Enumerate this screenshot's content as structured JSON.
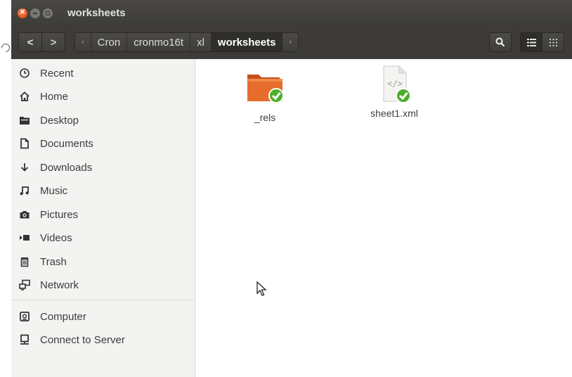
{
  "window": {
    "title": "worksheets"
  },
  "toolbar": {
    "back_glyph": "<",
    "forward_glyph": ">",
    "breadcrumb": [
      "Cron",
      "cronmo16t",
      "xl",
      "worksheets"
    ],
    "left_arrow": "‹",
    "right_arrow": "›"
  },
  "sidebar": {
    "items": [
      {
        "label": "Recent",
        "icon": "clock-icon"
      },
      {
        "label": "Home",
        "icon": "home-icon"
      },
      {
        "label": "Desktop",
        "icon": "desktop-folder-icon"
      },
      {
        "label": "Documents",
        "icon": "document-icon"
      },
      {
        "label": "Downloads",
        "icon": "download-icon"
      },
      {
        "label": "Music",
        "icon": "music-icon"
      },
      {
        "label": "Pictures",
        "icon": "camera-icon"
      },
      {
        "label": "Videos",
        "icon": "video-icon"
      },
      {
        "label": "Trash",
        "icon": "trash-icon"
      },
      {
        "label": "Network",
        "icon": "network-icon"
      },
      {
        "label": "Computer",
        "icon": "computer-icon"
      },
      {
        "label": "Connect to Server",
        "icon": "server-icon"
      }
    ]
  },
  "files": [
    {
      "name": "_rels",
      "type": "folder",
      "status": "synced"
    },
    {
      "name": "sheet1.xml",
      "type": "xml",
      "status": "synced"
    }
  ],
  "colors": {
    "accent": "#e2511c",
    "folder": "#e0682a",
    "check": "#4caf2a"
  }
}
